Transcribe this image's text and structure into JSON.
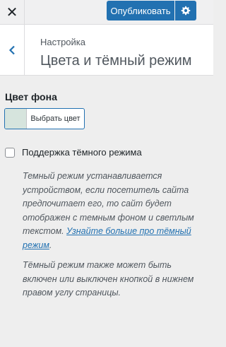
{
  "topbar": {
    "close_icon": "close-icon",
    "close_glyph": "✕",
    "publish_label": "Опубликовать",
    "settings_icon": "gear-icon"
  },
  "header": {
    "back_icon": "chevron-left-icon",
    "breadcrumb": "Настройка",
    "title": "Цвета и тёмный режим"
  },
  "background_color": {
    "label": "Цвет фона",
    "button_label": "Выбрать цвет",
    "swatch_color": "#d6e4dd"
  },
  "dark_mode": {
    "checkbox_label": "Поддержка тёмного режима",
    "checked": false,
    "description_1": "Темный режим устанавливается устройством, если посетитель сайта предпочитает его, то сайт будет отображен с темным фоном и светлым текстом. ",
    "learn_more_link": "Узнайте больше про тёмный режим",
    "description_1_end": ".",
    "description_2": "Тёмный режим также может быть включен или выключен кнопкой в нижнем правом углу страницы."
  },
  "colors": {
    "accent": "#2271b1",
    "panel_bg": "#eeeeee"
  }
}
